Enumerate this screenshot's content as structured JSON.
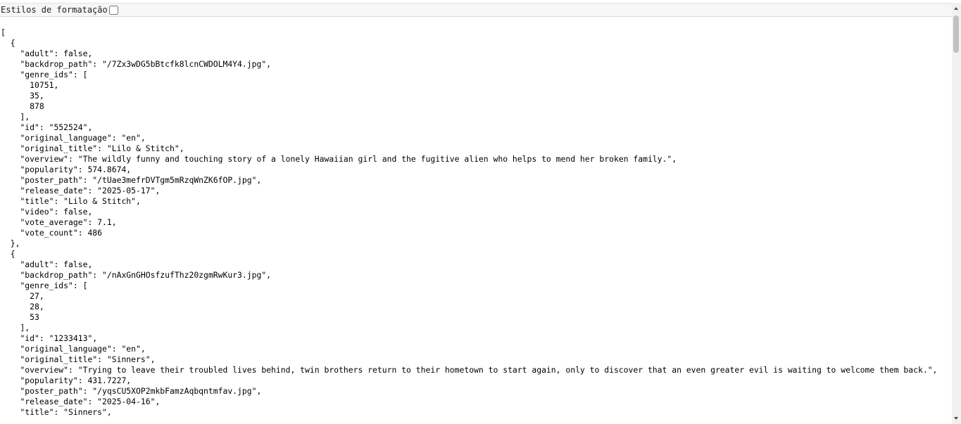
{
  "toolbar": {
    "label": "Estilos de formatação",
    "checkbox_checked": false
  },
  "json_text": "[\n  {\n    \"adult\": false,\n    \"backdrop_path\": \"/7Zx3wDG5bBtcfk8lcnCWDOLM4Y4.jpg\",\n    \"genre_ids\": [\n      10751,\n      35,\n      878\n    ],\n    \"id\": \"552524\",\n    \"original_language\": \"en\",\n    \"original_title\": \"Lilo & Stitch\",\n    \"overview\": \"The wildly funny and touching story of a lonely Hawaiian girl and the fugitive alien who helps to mend her broken family.\",\n    \"popularity\": 574.8674,\n    \"poster_path\": \"/tUae3mefrDVTgm5mRzqWnZK6fOP.jpg\",\n    \"release_date\": \"2025-05-17\",\n    \"title\": \"Lilo & Stitch\",\n    \"video\": false,\n    \"vote_average\": 7.1,\n    \"vote_count\": 486\n  },\n  {\n    \"adult\": false,\n    \"backdrop_path\": \"/nAxGnGHOsfzufThz20zgmRwKur3.jpg\",\n    \"genre_ids\": [\n      27,\n      28,\n      53\n    ],\n    \"id\": \"1233413\",\n    \"original_language\": \"en\",\n    \"original_title\": \"Sinners\",\n    \"overview\": \"Trying to leave their troubled lives behind, twin brothers return to their hometown to start again, only to discover that an even greater evil is waiting to welcome them back.\",\n    \"popularity\": 431.7227,\n    \"poster_path\": \"/yqsCU5XOP2mkbFamzAqbqntmfav.jpg\",\n    \"release_date\": \"2025-04-16\",\n    \"title\": \"Sinners\","
}
